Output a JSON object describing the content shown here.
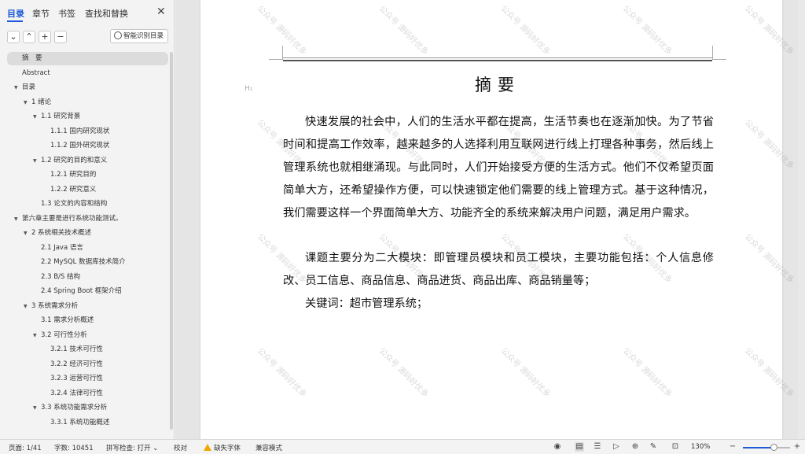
{
  "sidebar": {
    "tabs": [
      {
        "label": "目录",
        "active": true
      },
      {
        "label": "章节",
        "active": false
      },
      {
        "label": "书签",
        "active": false
      },
      {
        "label": "查找和替换",
        "active": false
      }
    ],
    "close_icon": "close-icon",
    "toolbar": {
      "collapse_icon": "chevron-down-icon",
      "expand_icon": "chevron-up-icon",
      "add_icon": "plus-icon",
      "remove_icon": "minus-icon",
      "smart_toc_label": "智能识别目录"
    },
    "toc": [
      {
        "label": "摘　要",
        "level": 0,
        "caret": false,
        "selected": true
      },
      {
        "label": "Abstract",
        "level": 0,
        "caret": false,
        "selected": false
      },
      {
        "label": "目录",
        "level": 0,
        "caret": true,
        "selected": false
      },
      {
        "label": "1 绪论",
        "level": 1,
        "caret": true,
        "selected": false
      },
      {
        "label": "1.1  研究背景",
        "level": 2,
        "caret": true,
        "selected": false
      },
      {
        "label": "1.1.1 国内研究现状",
        "level": 3,
        "caret": false,
        "selected": false
      },
      {
        "label": "1.1.2 国外研究现状",
        "level": 3,
        "caret": false,
        "selected": false
      },
      {
        "label": "1.2 研究的目的和意义",
        "level": 2,
        "caret": true,
        "selected": false
      },
      {
        "label": "1.2.1 研究目的",
        "level": 3,
        "caret": false,
        "selected": false
      },
      {
        "label": "1.2.2  研究意义",
        "level": 3,
        "caret": false,
        "selected": false
      },
      {
        "label": "1.3  论文的内容和结构",
        "level": 2,
        "caret": false,
        "selected": false
      },
      {
        "label": "第六章主要是进行系统功能测试。",
        "level": 0,
        "caret": true,
        "selected": false
      },
      {
        "label": "2 系统相关技术概述",
        "level": 1,
        "caret": true,
        "selected": false
      },
      {
        "label": "2.1 Java 语言",
        "level": 2,
        "caret": false,
        "selected": false
      },
      {
        "label": "2.2 MySQL 数据库技术简介",
        "level": 2,
        "caret": false,
        "selected": false
      },
      {
        "label": "2.3 B/S 结构",
        "level": 2,
        "caret": false,
        "selected": false
      },
      {
        "label": "2.4 Spring Boot 框架介绍",
        "level": 2,
        "caret": false,
        "selected": false
      },
      {
        "label": "3 系统需求分析",
        "level": 1,
        "caret": true,
        "selected": false
      },
      {
        "label": "3.1 需求分析概述",
        "level": 2,
        "caret": false,
        "selected": false
      },
      {
        "label": "3.2 可行性分析",
        "level": 2,
        "caret": true,
        "selected": false
      },
      {
        "label": "3.2.1 技术可行性",
        "level": 3,
        "caret": false,
        "selected": false
      },
      {
        "label": "3.2.2 经济可行性",
        "level": 3,
        "caret": false,
        "selected": false
      },
      {
        "label": "3.2.3 运营可行性",
        "level": 3,
        "caret": false,
        "selected": false
      },
      {
        "label": "3.2.4 法律可行性",
        "level": 3,
        "caret": false,
        "selected": false
      },
      {
        "label": "3.3 系统功能需求分析",
        "level": 2,
        "caret": true,
        "selected": false
      },
      {
        "label": "3.3.1 系统功能概述",
        "level": 3,
        "caret": false,
        "selected": false
      }
    ]
  },
  "document": {
    "heading_marker": "H₁",
    "title": "摘要",
    "paragraphs": [
      "快速发展的社会中，人们的生活水平都在提高，生活节奏也在逐渐加快。为了节省时间和提高工作效率，越来越多的人选择利用互联网进行线上打理各种事务，然后线上管理系统也就相继涌现。与此同时，人们开始接受方便的生活方式。他们不仅希望页面简单大方，还希望操作方便，可以快速锁定他们需要的线上管理方式。基于这种情况，我们需要这样一个界面简单大方、功能齐全的系统来解决用户问题，满足用户需求。",
      "课题主要分为二大模块：即管理员模块和员工模块，主要功能包括：个人信息修改、员工信息、商品信息、商品进货、商品出库、商品销量等；",
      "关键词：超市管理系统；"
    ],
    "watermark": "公众号 源码好优多"
  },
  "statusbar": {
    "page": "页面: 1/41",
    "word_count": "字数: 10451",
    "spell_check": "拼写检查: 打开",
    "proofread": "校对",
    "missing_font": "缺失字体",
    "compat_mode": "兼容模式",
    "zoom_level": "130%",
    "zoom_fraction": 0.65,
    "icons": [
      "eye-icon",
      "page-view-icon",
      "outline-view-icon",
      "play-icon",
      "globe-icon",
      "pen-icon",
      "fit-page-icon",
      "zoom-out-icon",
      "zoom-in-icon"
    ]
  }
}
